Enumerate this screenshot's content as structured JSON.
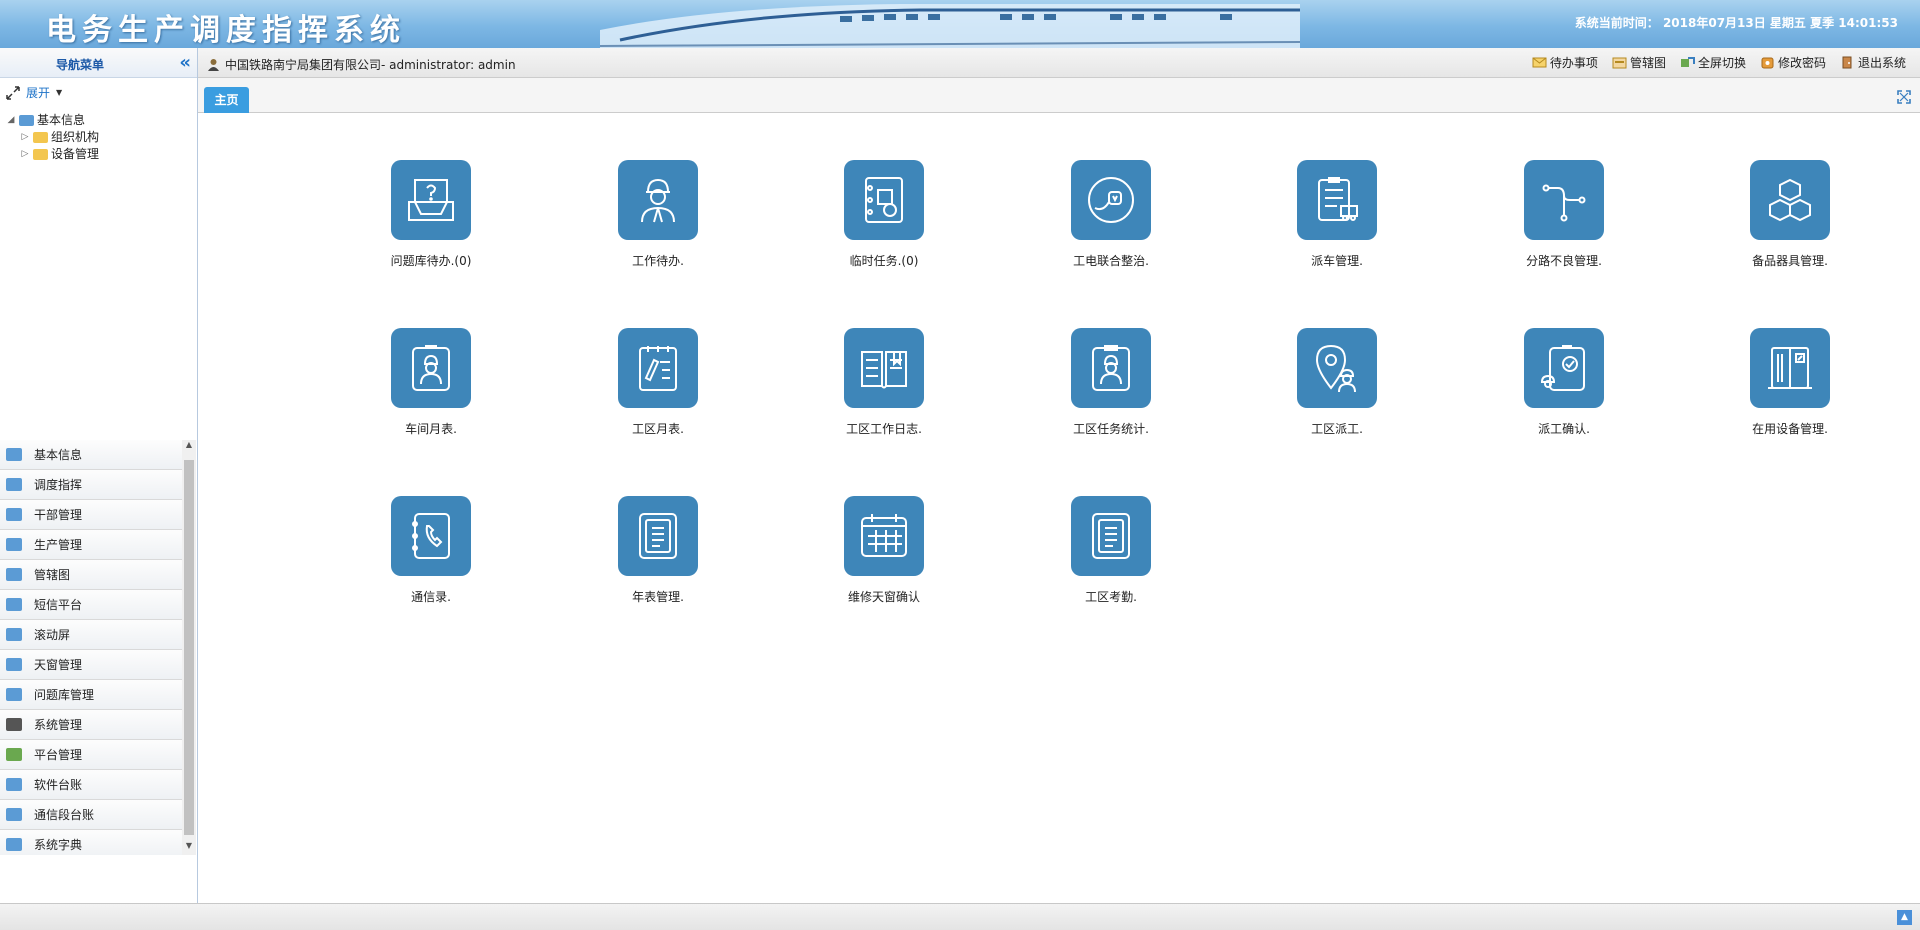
{
  "header": {
    "title": "电务生产调度指挥系统",
    "system_time": "系统当前时间： 2018年07月13日 星期五 夏季 14:01:53"
  },
  "topbar": {
    "user_text": "中国铁路南宁局集团有限公司- administrator: admin",
    "tools": [
      {
        "label": "待办事项",
        "icon": "mail-icon"
      },
      {
        "label": "管辖图",
        "icon": "map-icon"
      },
      {
        "label": "全屏切换",
        "icon": "fullscreen-icon"
      },
      {
        "label": "修改密码",
        "icon": "key-icon"
      },
      {
        "label": "退出系统",
        "icon": "exit-icon"
      }
    ]
  },
  "nav": {
    "title": "导航菜单",
    "expand_label": "展开",
    "tree": {
      "root": "基本信息",
      "children": [
        "组织机构",
        "设备管理"
      ]
    },
    "accordion": [
      "基本信息",
      "调度指挥",
      "干部管理",
      "生产管理",
      "管辖图",
      "短信平台",
      "滚动屏",
      "天窗管理",
      "问题库管理",
      "系统管理",
      "平台管理",
      "软件台账",
      "通信段台账",
      "系统字典"
    ]
  },
  "tabs": {
    "active": "主页"
  },
  "tiles": [
    {
      "label": "问题库待办.(0)",
      "icon": "question-tray-icon"
    },
    {
      "label": "工作待办.",
      "icon": "worker-icon"
    },
    {
      "label": "临时任务.(0)",
      "icon": "task-book-icon"
    },
    {
      "label": "工电联合整治.",
      "icon": "plug-circle-icon"
    },
    {
      "label": "派车管理.",
      "icon": "clipboard-truck-icon"
    },
    {
      "label": "分路不良管理.",
      "icon": "branch-path-icon"
    },
    {
      "label": "备品器具管理.",
      "icon": "cubes-icon"
    },
    {
      "label": "车间月表.",
      "icon": "worker-badge-icon"
    },
    {
      "label": "工区月表.",
      "icon": "notepad-pen-icon"
    },
    {
      "label": "工区工作日志.",
      "icon": "open-book-icon"
    },
    {
      "label": "工区任务统计.",
      "icon": "worker-clipboard-icon"
    },
    {
      "label": "工区派工.",
      "icon": "location-worker-icon"
    },
    {
      "label": "派工确认.",
      "icon": "worker-check-icon"
    },
    {
      "label": "在用设备管理.",
      "icon": "cabinet-icon"
    },
    {
      "label": "通信录.",
      "icon": "phone-book-icon"
    },
    {
      "label": "年表管理.",
      "icon": "document-icon"
    },
    {
      "label": "维修天窗确认",
      "icon": "calendar-grid-icon"
    },
    {
      "label": "工区考勤.",
      "icon": "document-list-icon"
    }
  ],
  "colors": {
    "tile": "#3e86b9",
    "accent": "#3a9de0"
  }
}
